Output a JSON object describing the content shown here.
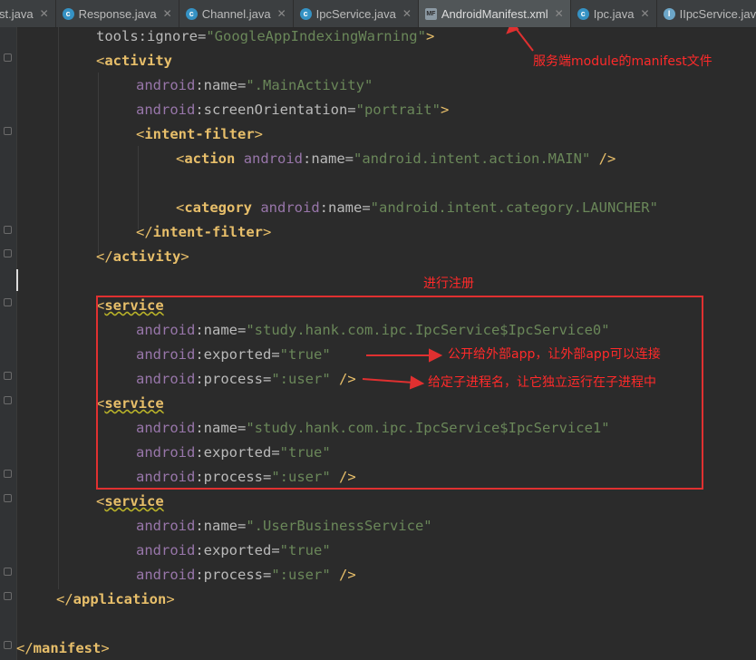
{
  "tabs": [
    {
      "label": "st.java",
      "icon": "none",
      "active": false
    },
    {
      "label": "Response.java",
      "icon": "class-icon",
      "active": false
    },
    {
      "label": "Channel.java",
      "icon": "class-icon",
      "active": false
    },
    {
      "label": "IpcService.java",
      "icon": "class-icon",
      "active": false
    },
    {
      "label": "AndroidManifest.xml",
      "icon": "xml-file-icon",
      "active": true
    },
    {
      "label": "Ipc.java",
      "icon": "class-icon",
      "active": false
    },
    {
      "label": "IIpcService.java",
      "icon": "interface-icon",
      "active": false
    }
  ],
  "code": {
    "l0_attr": "tools:ignore=",
    "l0_val": "\"GoogleAppIndexingWarning\"",
    "l0_end": ">",
    "activity_tag": "activity",
    "android_ns": "android",
    "name_attr": ":name=",
    "main_activity": "\".MainActivity\"",
    "orientation_attr": ":screenOrientation=",
    "portrait": "\"portrait\"",
    "intent_filter": "intent-filter",
    "action_tag": "action",
    "action_main": "\"android.intent.action.MAIN\"",
    "category_tag": "category",
    "category_launcher": "\"android.intent.category.LAUNCHER\"",
    "service_tag": "service",
    "service0": "\"study.hank.com.ipc.IpcService$IpcService0\"",
    "service1": "\"study.hank.com.ipc.IpcService$IpcService1\"",
    "user_business": "\".UserBusinessService\"",
    "exported_attr": ":exported=",
    "true_val": "\"true\"",
    "process_attr": ":process=",
    "user_val": "\":user\"",
    "self_close": " />",
    "application_tag": "application",
    "manifest_tag": "manifest"
  },
  "annotations": {
    "manifest_note": "服务端module的manifest文件",
    "register_note": "进行注册",
    "exported_note": "公开给外部app，让外部app可以连接",
    "process_note": "给定子进程名，让它独立运行在子进程中"
  },
  "colors": {
    "annotation_red": "#ff2a2a",
    "tag": "#e8bf6a",
    "namespace": "#9876aa",
    "string": "#6a8759",
    "attribute": "#bababa"
  }
}
